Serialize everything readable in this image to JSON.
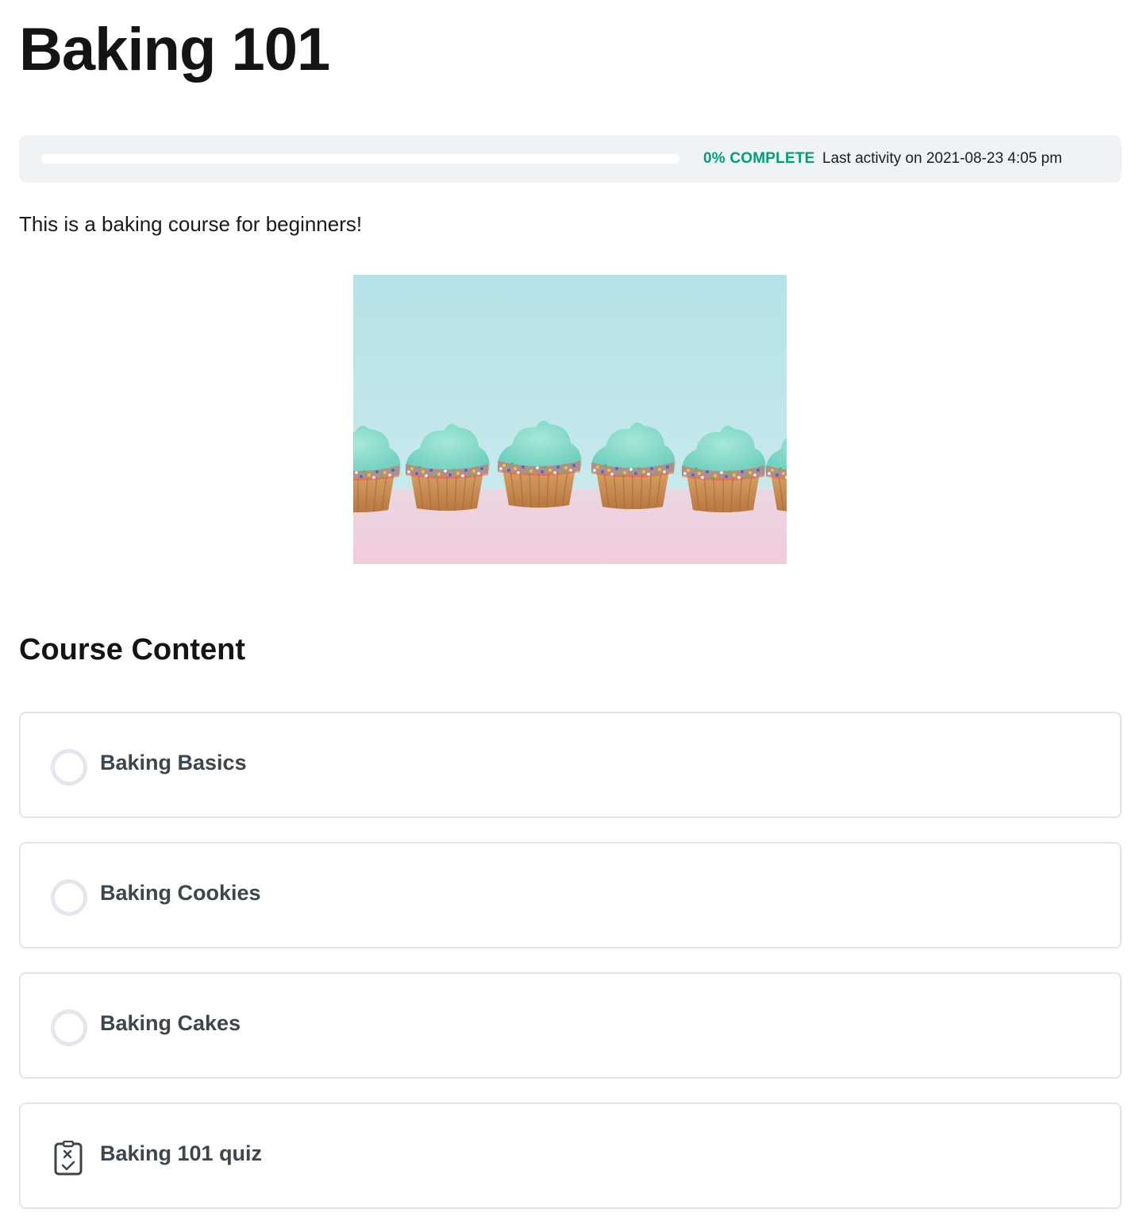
{
  "course": {
    "title": "Baking 101",
    "description": "This is a baking course for beginners!",
    "image_alt": "Row of cupcakes with mint frosting and rainbow sprinkles"
  },
  "progress": {
    "percent_complete": 0,
    "percent_label": "0% COMPLETE",
    "last_activity": "Last activity on 2021-08-23 4:05 pm",
    "accent_color": "#019e7c"
  },
  "content_section": {
    "heading": "Course Content",
    "items": [
      {
        "title": "Baking Basics",
        "type": "lesson",
        "icon": "empty-circle-icon",
        "completed": false
      },
      {
        "title": "Baking Cookies",
        "type": "lesson",
        "icon": "empty-circle-icon",
        "completed": false
      },
      {
        "title": "Baking Cakes",
        "type": "lesson",
        "icon": "empty-circle-icon",
        "completed": false
      },
      {
        "title": "Baking 101 quiz",
        "type": "quiz",
        "icon": "quiz-icon",
        "completed": false
      }
    ]
  }
}
